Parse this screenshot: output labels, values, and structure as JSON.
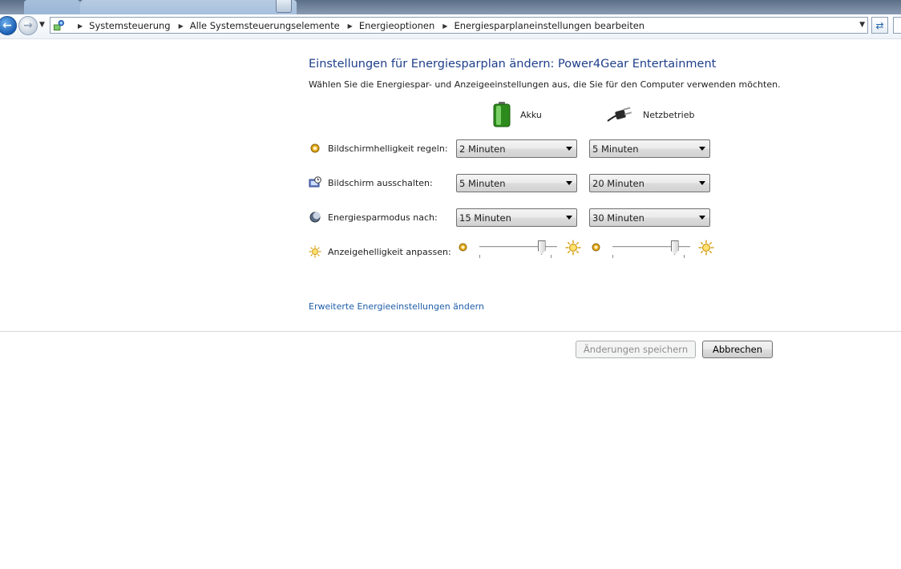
{
  "breadcrumb": [
    "Systemsteuerung",
    "Alle Systemsteuerungselemente",
    "Energieoptionen",
    "Energiesparplaneinstellungen bearbeiten"
  ],
  "page": {
    "title": "Einstellungen für Energiesparplan ändern: Power4Gear Entertainment",
    "subtitle": "Wählen Sie die Energiespar- und Anzeigeeinstellungen aus, die Sie für den Computer verwenden möchten."
  },
  "columns": {
    "battery": {
      "label": "Akku",
      "icon": "battery-icon"
    },
    "plugged": {
      "label": "Netzbetrieb",
      "icon": "power-plug-icon"
    }
  },
  "settings": [
    {
      "label": "Bildschirmhelligkeit regeln:",
      "icon": "dim-brightness-icon",
      "battery": "2 Minuten",
      "plugged": "5 Minuten"
    },
    {
      "label": "Bildschirm ausschalten:",
      "icon": "monitor-clock-icon",
      "battery": "5 Minuten",
      "plugged": "20 Minuten"
    },
    {
      "label": "Energiesparmodus nach:",
      "icon": "moon-sleep-icon",
      "battery": "15 Minuten",
      "plugged": "30 Minuten"
    }
  ],
  "brightness": {
    "label": "Anzeigehelligkeit anpassen:",
    "icon": "sun-icon",
    "battery_level": 0.8,
    "plugged_level": 0.8
  },
  "advanced_link": "Erweiterte Energieeinstellungen ändern",
  "buttons": {
    "save": "Änderungen speichern",
    "cancel": "Abbrechen",
    "save_enabled": false
  }
}
